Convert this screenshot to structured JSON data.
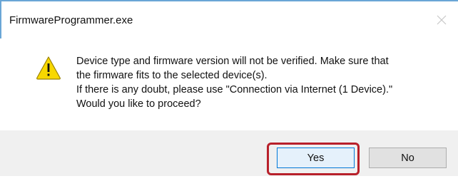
{
  "window": {
    "title": "FirmwareProgrammer.exe",
    "close_icon": "close-icon"
  },
  "message": {
    "icon": "warning-icon",
    "lines": [
      "Device type and firmware version will not be verified. Make sure that",
      "the firmware fits to the selected device(s).",
      "If there is any doubt, please use \"Connection via Internet (1 Device).\"",
      "Would you like to proceed?"
    ]
  },
  "buttons": {
    "yes_label": "Yes",
    "no_label": "No"
  },
  "colors": {
    "accent_border": "#6aa6d6",
    "highlight": "#b8202a",
    "warning_fill": "#f8d800",
    "focus_border": "#0078d7"
  }
}
